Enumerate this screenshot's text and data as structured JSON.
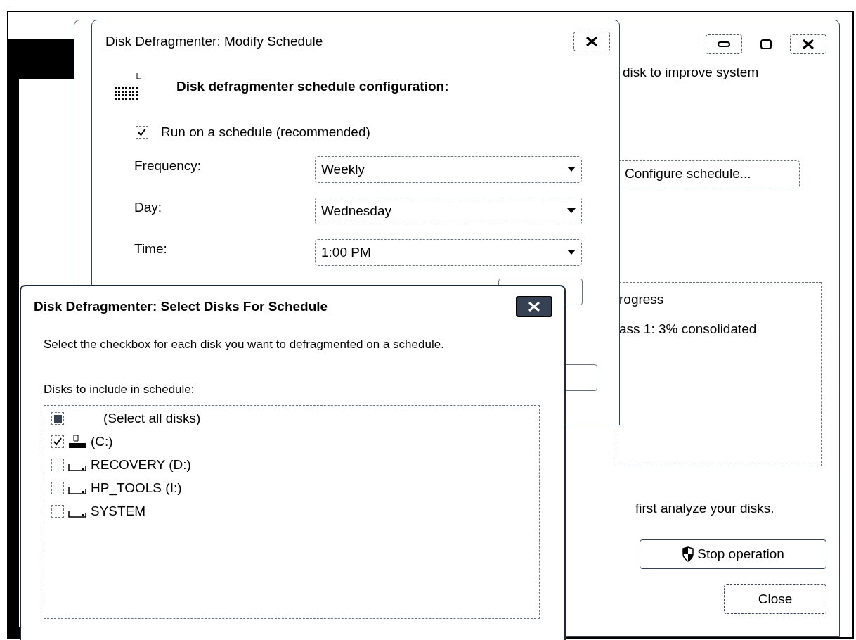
{
  "main_window": {
    "intro_text": "disk to improve system",
    "configure_button": "Configure schedule...",
    "progress": {
      "heading": "rogress",
      "status": "ass 1: 3% consolidated"
    },
    "hint_text": "first analyze your disks.",
    "stop_button": "Stop operation",
    "close_button": "Close"
  },
  "modify_dialog": {
    "title": "Disk Defragmenter: Modify Schedule",
    "heading": "Disk defragmenter schedule configuration:",
    "run_on_schedule": {
      "label": "Run on a schedule (recommended)",
      "checked": true
    },
    "fields": [
      {
        "label": "Frequency:",
        "value": "Weekly"
      },
      {
        "label": "Day:",
        "value": "Wednesday"
      },
      {
        "label": "Time:",
        "value": "1:00 PM"
      }
    ]
  },
  "select_dialog": {
    "title": "Disk Defragmenter: Select Disks For Schedule",
    "description": "Select the checkbox for each disk you want to defragmented on a schedule.",
    "list_label": "Disks to include in schedule:",
    "disks": [
      {
        "name": "(Select all disks)",
        "checked": false,
        "indeterminate": true,
        "kind": "all"
      },
      {
        "name": "(C:)",
        "checked": true,
        "indeterminate": false,
        "kind": "system"
      },
      {
        "name": "RECOVERY (D:)",
        "checked": false,
        "indeterminate": false,
        "kind": "drive"
      },
      {
        "name": "HP_TOOLS (I:)",
        "checked": false,
        "indeterminate": false,
        "kind": "drive"
      },
      {
        "name": "SYSTEM",
        "checked": false,
        "indeterminate": false,
        "kind": "drive"
      }
    ]
  }
}
